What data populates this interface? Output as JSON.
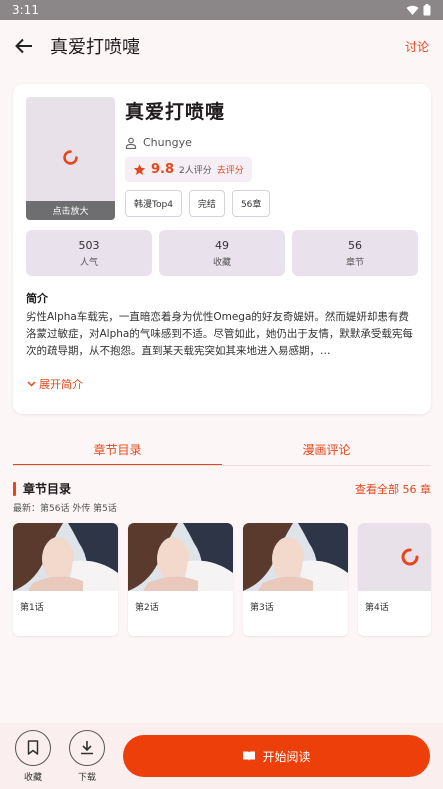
{
  "status_bar": {
    "time": "3:11"
  },
  "app_bar": {
    "title": "真爱打喷嚏",
    "comment_link": "讨论"
  },
  "book": {
    "title": "真爱打喷嚏",
    "zoom_label": "点击放大",
    "author": "Chungye",
    "rating": {
      "score": "9.8",
      "count": "2人评分",
      "action": "去评分"
    },
    "tags": [
      "韩漫Top4",
      "完结",
      "56章"
    ]
  },
  "stats": [
    {
      "value": "503",
      "label": "人气"
    },
    {
      "value": "49",
      "label": "收藏"
    },
    {
      "value": "56",
      "label": "章节"
    }
  ],
  "intro": {
    "title": "简介",
    "text": "劣性Alpha车载宪，一直暗恋着身为优性Omega的好友奇媞妍。然而媞妍却患有费洛蒙过敏症，对Alpha的气味感到不适。尽管如此，她仍出于友情，默默承受载宪每次的疏导期，从不抱怨。直到某天载宪突如其来地进入易感期，…",
    "expand": "展开简介"
  },
  "tabs": [
    "章节目录",
    "漫画评论"
  ],
  "chapter_section": {
    "title": "章节目录",
    "view_all": "查看全部 56 章",
    "latest": "最新：第56话 外传 第5话",
    "chapters": [
      "第1话",
      "第2话",
      "第3话",
      "第4话"
    ]
  },
  "bottom_bar": {
    "favorite": "收藏",
    "download": "下载",
    "read": "开始阅读"
  },
  "colors": {
    "accent": "#e7461a",
    "read_button": "#ec3f0a",
    "stat_bg": "#e9e1ec"
  }
}
